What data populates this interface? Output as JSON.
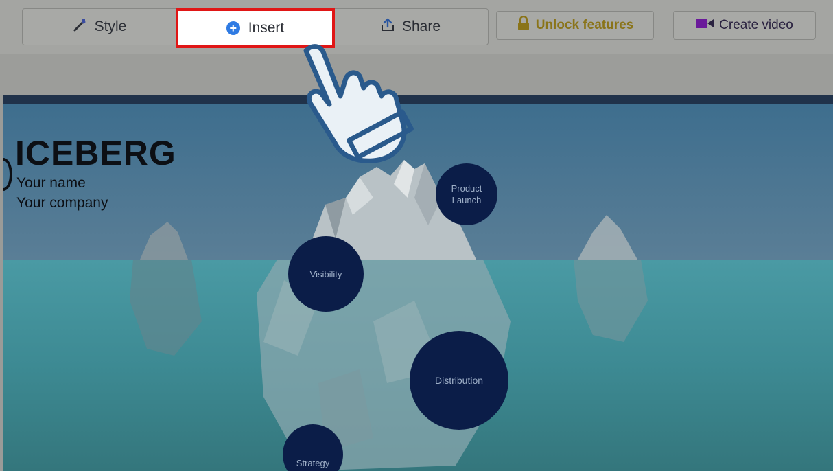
{
  "toolbar": {
    "style_label": "Style",
    "insert_label": "Insert",
    "share_label": "Share",
    "unlock_label": "Unlock features",
    "video_label": "Create video"
  },
  "slide": {
    "title": "ICEBERG",
    "subtitle_line1": "Your name",
    "subtitle_line2": "Your company",
    "topics": [
      "Product Launch",
      "Visibility",
      "Distribution",
      "Strategy"
    ],
    "topic_line1": "Product",
    "topic_line2": "Launch"
  },
  "colors": {
    "highlight_border": "#e01616",
    "topic_circle": "#0b1d48",
    "unlock_text": "#8a7419",
    "video_icon": "#6a1a9a"
  },
  "icons": {
    "style": "magic-wand-icon",
    "insert": "plus-circle-icon",
    "share": "upload-icon",
    "unlock": "lock-icon",
    "video": "video-camera-icon",
    "pointer": "pointing-hand-icon"
  }
}
